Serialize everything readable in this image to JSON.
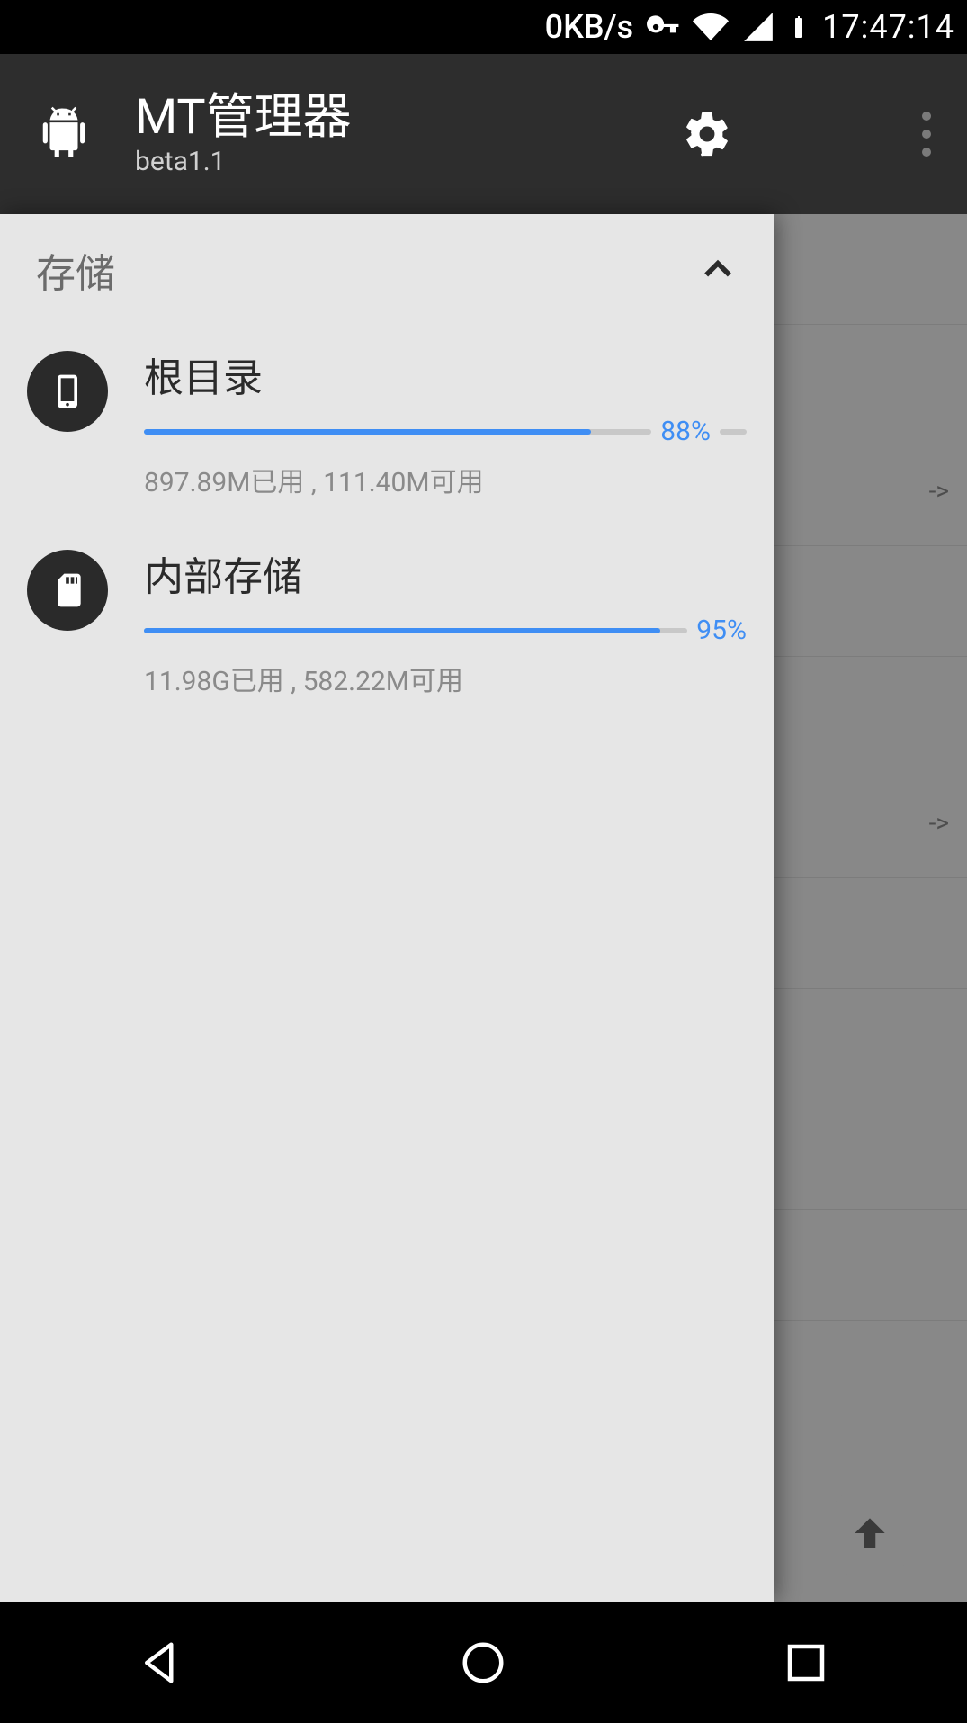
{
  "statusbar": {
    "speed": "0KB/s",
    "time": "17:47:14"
  },
  "appbar": {
    "title": "MT管理器",
    "subtitle": "beta1.1"
  },
  "drawer": {
    "section_label": "存储",
    "items": [
      {
        "label": "根目录",
        "percent_text": "88%",
        "percent": 88,
        "sub": "897.89M已用 , 111.40M可用"
      },
      {
        "label": "内部存储",
        "percent_text": "95%",
        "percent": 95,
        "sub": "11.98G已用 , 582.22M可用"
      }
    ]
  },
  "bg_list": {
    "rows": [
      "",
      "",
      "->",
      "",
      "",
      "->",
      "",
      "",
      "",
      "",
      ""
    ]
  }
}
